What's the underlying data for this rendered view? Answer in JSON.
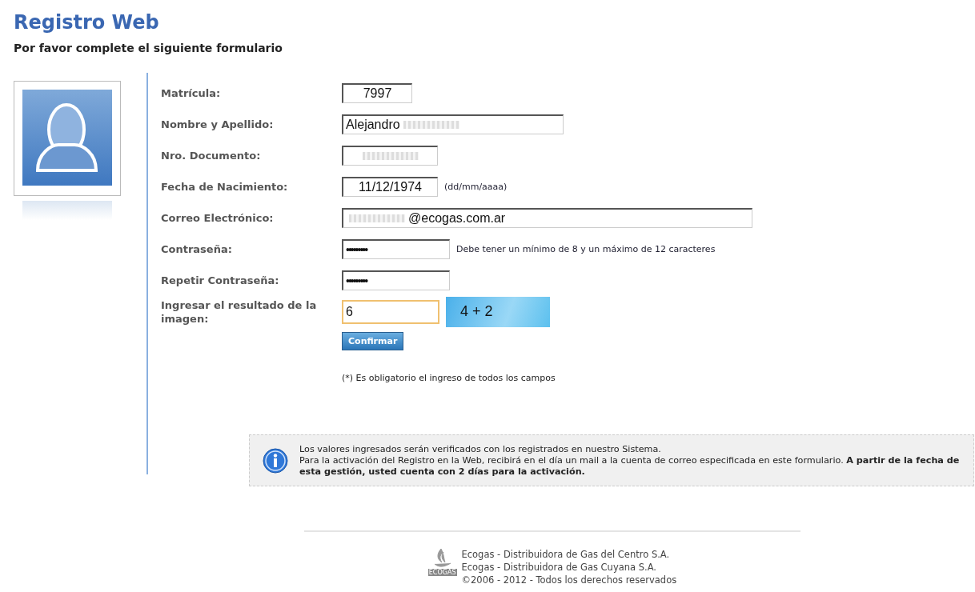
{
  "header": {
    "title": "Registro Web",
    "subtitle": "Por favor complete el siguiente formulario"
  },
  "form": {
    "fields": [
      {
        "label": "Matrícula:",
        "kind": "text",
        "value": "7997",
        "focused": false
      },
      {
        "label": "Nombre y Apellido:",
        "kind": "text",
        "value": "Alejandro",
        "focused": false
      },
      {
        "label": "Nro. Documento:",
        "kind": "text",
        "focused": false
      },
      {
        "label": "Fecha de Nacimiento:",
        "kind": "text",
        "value": "11/12/1974",
        "focused": false,
        "hint": "(dd/mm/aaaa)"
      },
      {
        "label": "Correo Electrónico:",
        "kind": "text",
        "value": "@ecogas.com.ar",
        "focused": false
      },
      {
        "label": "Contraseña:",
        "kind": "password",
        "value": "•••••••••",
        "focused": false,
        "hint": "Debe tener un mínimo de 8 y un máximo de 12 caracteres"
      },
      {
        "label": "Repetir Contraseña:",
        "kind": "password",
        "value": "•••••••••",
        "focused": false
      },
      {
        "label": "Ingresar el resultado de la imagen:",
        "kind": "captcha",
        "value": "6",
        "focused": true,
        "captcha": "4 + 2"
      }
    ],
    "submit": "Confirmar",
    "required_note": "(*) Es obligatorio el ingreso de todos los campos"
  },
  "info": {
    "lines": [
      "Los valores ingresados serán verificados con los registrados en nuestro Sistema.",
      "Para la activación del Registro en la Web, recibirá en el día un mail a la cuenta de correo especificada en este formulario.  **A partir de la fecha de esta gestión, usted cuenta con 2 días para la activación.**"
    ]
  },
  "footer": {
    "logo": "ECOGAS",
    "lines": [
      "Ecogas - Distribuidora de Gas del Centro S.A.",
      "Ecogas - Distribuidora de Gas Cuyana S.A.",
      "©2006 - 2012 - Todos los derechos reservados"
    ]
  }
}
